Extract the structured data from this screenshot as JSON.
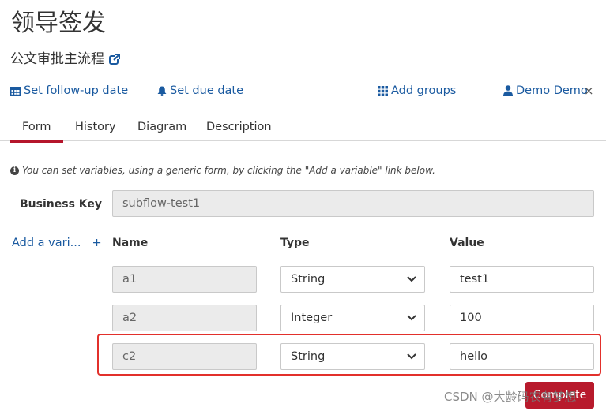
{
  "header": {
    "title": "领导签发",
    "process_name": "公文审批主流程"
  },
  "actions": {
    "follow_up": "Set follow-up date",
    "due_date": "Set due date",
    "add_groups": "Add groups",
    "assignee": "Demo Demo",
    "remove_assignee": "×"
  },
  "tabs": [
    {
      "label": "Form",
      "active": true
    },
    {
      "label": "History",
      "active": false
    },
    {
      "label": "Diagram",
      "active": false
    },
    {
      "label": "Description",
      "active": false
    }
  ],
  "form": {
    "hint": "You can set variables, using a generic form, by clicking the \"Add a variable\" link below.",
    "business_key_label": "Business Key",
    "business_key_value": "subflow-test1",
    "add_variable_label": "Add a vari...",
    "add_variable_plus": "+",
    "columns": {
      "name": "Name",
      "type": "Type",
      "value": "Value"
    },
    "variables": [
      {
        "name": "a1",
        "type": "String",
        "value": "test1"
      },
      {
        "name": "a2",
        "type": "Integer",
        "value": "100"
      },
      {
        "name": "c2",
        "type": "String",
        "value": "hello"
      }
    ],
    "submit_label": "Complete"
  },
  "watermark": "CSDN @大龄码农有梦想",
  "colors": {
    "link": "#1a5aa0",
    "accent": "#b5152b",
    "highlight": "#e2302b",
    "button": "#b81a2c"
  }
}
